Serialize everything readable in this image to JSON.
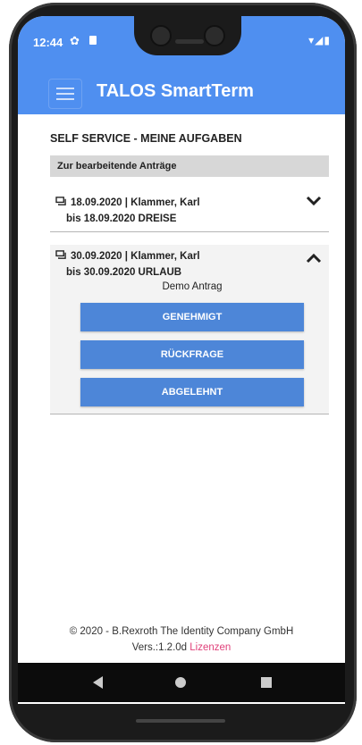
{
  "status": {
    "time": "12:44"
  },
  "app": {
    "title": "TALOS SmartTerm"
  },
  "page": {
    "title": "SELF SERVICE - MEINE AUFGABEN",
    "section_header": "Zur bearbeitende Anträge"
  },
  "tasks": [
    {
      "line1": "18.09.2020 | Klammer, Karl",
      "line2": "bis 18.09.2020 DREISE",
      "expanded": false
    },
    {
      "line1": "30.09.2020 | Klammer, Karl",
      "line2": "bis 30.09.2020 URLAUB",
      "description": "Demo Antrag",
      "expanded": true,
      "actions": [
        "GENEHMIGT",
        "RÜCKFRAGE",
        "ABGELEHNT"
      ]
    }
  ],
  "footer": {
    "copyright": "© 2020 - B.Rexroth The Identity Company GmbH",
    "version": "Vers.:1.2.0d",
    "license_link": "Lizenzen"
  },
  "colors": {
    "primary": "#4f8ff0",
    "button": "#4d86d8",
    "link": "#e0407a"
  }
}
